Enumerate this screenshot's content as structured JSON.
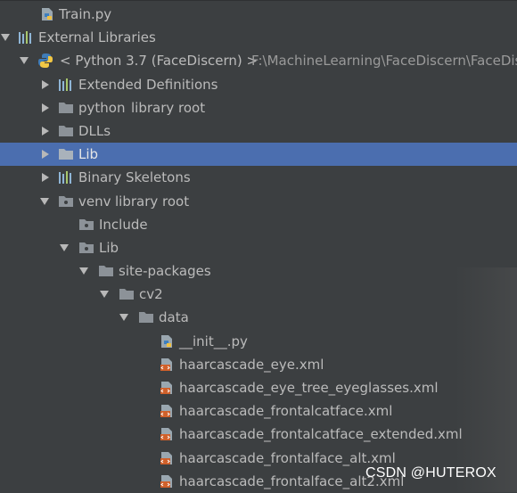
{
  "tree": {
    "train_file": "Train.py",
    "external_libraries": "External Libraries",
    "sdk_name": "< Python 3.7 (FaceDiscern) >",
    "sdk_path": "F:\\MachineLearning\\FaceDiscern\\FaceDisc",
    "extended_definitions": "Extended Definitions",
    "python_root": "python",
    "library_root_hint": "library root",
    "dlls": "DLLs",
    "lib": "Lib",
    "binary_skeletons": "Binary Skeletons",
    "venv": "venv",
    "include": "Include",
    "venv_lib": "Lib",
    "site_packages": "site-packages",
    "cv2": "cv2",
    "data": "data",
    "files": [
      "__init__.py",
      "haarcascade_eye.xml",
      "haarcascade_eye_tree_eyeglasses.xml",
      "haarcascade_frontalcatface.xml",
      "haarcascade_frontalcatface_extended.xml",
      "haarcascade_frontalface_alt.xml",
      "haarcascade_frontalface_alt2.xml"
    ]
  },
  "watermark": "CSDN @HUTEROX",
  "colors": {
    "background": "#3c3f41",
    "selection": "#4b6eaf",
    "text": "#bbbbbb",
    "hint": "#8c8c8c"
  }
}
